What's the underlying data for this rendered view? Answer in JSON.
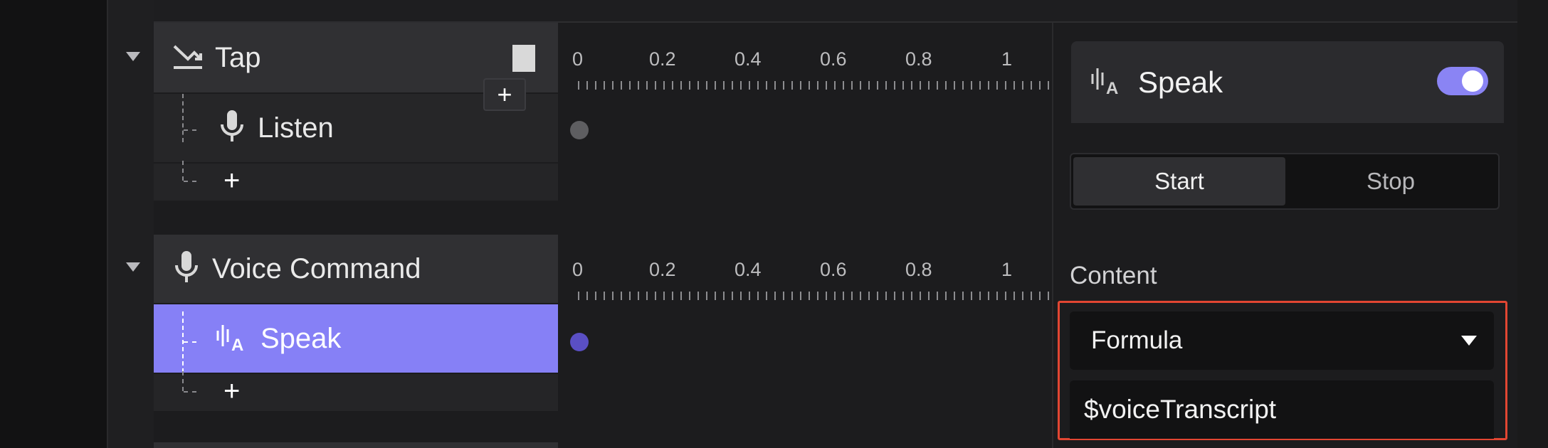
{
  "triggers": [
    {
      "title": "Tap",
      "icon": "tap-trigger-icon",
      "children": [
        {
          "label": "Listen",
          "icon": "microphone-icon"
        }
      ],
      "add_label": "+",
      "ruler": [
        "0",
        "0.2",
        "0.4",
        "0.6",
        "0.8",
        "1"
      ]
    },
    {
      "title": "Voice Command",
      "icon": "microphone-icon",
      "children": [
        {
          "label": "Speak",
          "icon": "speak-icon",
          "selected": true
        }
      ],
      "add_label": "+",
      "ruler": [
        "0",
        "0.2",
        "0.4",
        "0.6",
        "0.8",
        "1"
      ]
    }
  ],
  "floating_add_label": "+",
  "panel": {
    "title": "Speak",
    "toggle_on": true,
    "segments": [
      "Start",
      "Stop"
    ],
    "active_segment": "Start",
    "content_label": "Content",
    "content_mode": "Formula",
    "formula_value": "$voiceTranscript"
  },
  "colors": {
    "accent": "#8680f6",
    "highlight_border": "#e24632",
    "dot_default": "#5e5e61",
    "dot_selected": "#5a4fc4"
  }
}
